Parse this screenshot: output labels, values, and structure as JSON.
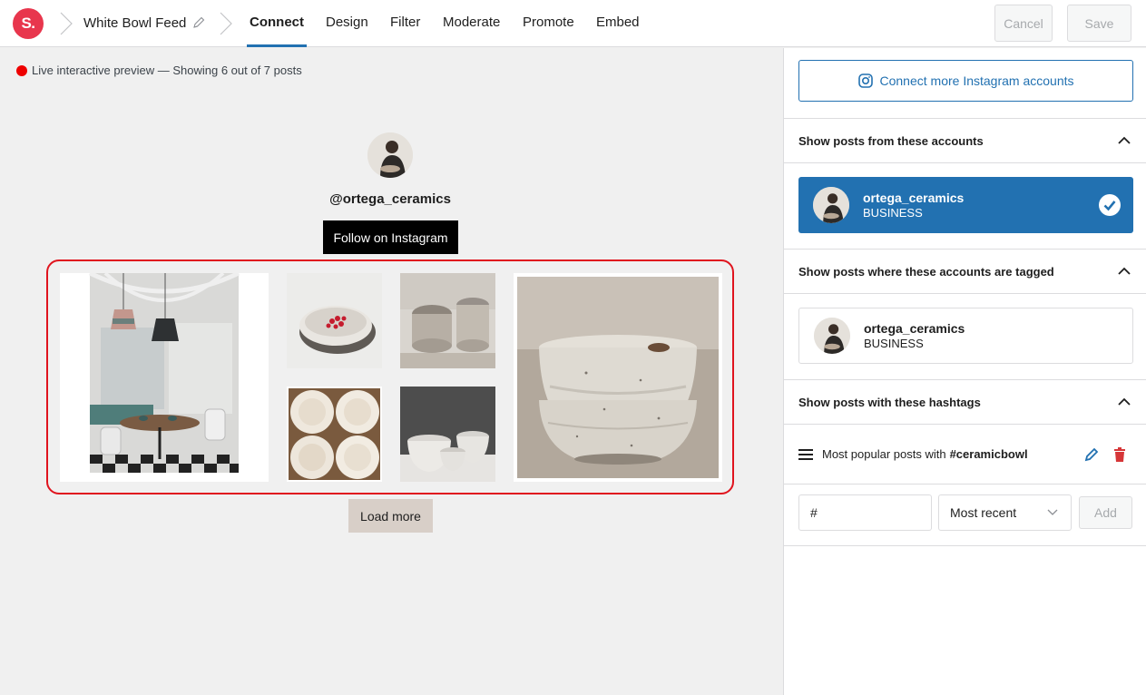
{
  "brand": {
    "logo_text": "S.",
    "accent": "#2271b1",
    "logo_color": "#e8364d"
  },
  "header": {
    "feed_name": "White Bowl Feed",
    "tabs": [
      {
        "label": "Connect",
        "active": true
      },
      {
        "label": "Design",
        "active": false
      },
      {
        "label": "Filter",
        "active": false
      },
      {
        "label": "Moderate",
        "active": false
      },
      {
        "label": "Promote",
        "active": false
      },
      {
        "label": "Embed",
        "active": false
      }
    ],
    "cancel_label": "Cancel",
    "save_label": "Save"
  },
  "preview": {
    "status_text": "Live interactive preview — Showing 6 out of 7 posts",
    "status_color": "#e00000",
    "username": "@ortega_ceramics",
    "follow_label": "Follow on Instagram",
    "load_more_label": "Load more",
    "grid_highlight_color": "#e0141e"
  },
  "sidebar": {
    "connect_label": "Connect more Instagram accounts",
    "sections": {
      "accounts": {
        "title": "Show posts from these accounts"
      },
      "tagged": {
        "title": "Show posts where these accounts are tagged"
      },
      "hashtags": {
        "title": "Show posts with these hashtags"
      }
    },
    "accounts": [
      {
        "name": "ortega_ceramics",
        "type": "BUSINESS",
        "selected": true
      }
    ],
    "tagged_accounts": [
      {
        "name": "ortega_ceramics",
        "type": "BUSINESS",
        "selected": false
      }
    ],
    "hashtag_rule": {
      "prefix": "Most popular posts with",
      "tag": "#ceramicbowl"
    },
    "add_hashtag": {
      "input_value": "#",
      "sort_value": "Most recent",
      "add_label": "Add"
    }
  }
}
